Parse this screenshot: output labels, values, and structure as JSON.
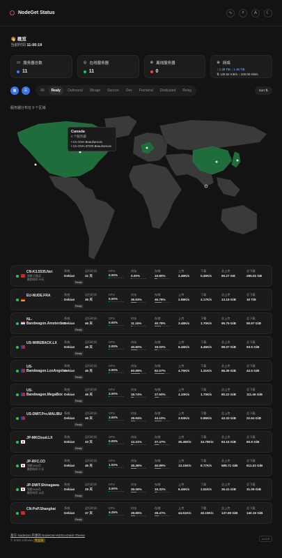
{
  "header": {
    "title": "NodeGet Status",
    "icons": [
      "activity-icon",
      "search-icon",
      "translate-icon",
      "theme-icon"
    ]
  },
  "greeting": "👋 概览",
  "time": {
    "label": "当前时间",
    "value": "11:00:19"
  },
  "cards": [
    {
      "title": "服务器总数",
      "value": "11",
      "color": "#3b82f6"
    },
    {
      "title": "在线服务器",
      "value": "11",
      "color": "#22c55e"
    },
    {
      "title": "离线服务器",
      "value": "0",
      "color": "#ef4444"
    },
    {
      "title": "网络",
      "line1": "↑ 1.38 TiB  ↓ 1.46 TiB",
      "line2": "⇅ 125.62 KiB/s  ↓ 100.05 KiB/s"
    }
  ],
  "toolbar": {
    "tabs": [
      "All",
      "Realy",
      "Outbound",
      "Mirage",
      "Service",
      "Dev",
      "Frontend",
      "Dedicated",
      "Relay"
    ],
    "active": "Realy",
    "sort": "Sort ⇅"
  },
  "map": {
    "note": "服务器分布在 9 个区域",
    "tooltip": {
      "country": "Canada",
      "count": "2 个服务器",
      "servers": [
        "CA-OVH.Beauharnois",
        "CA-OVH.STOR.Beauharnois"
      ]
    }
  },
  "labels": {
    "system": "系统",
    "uptime": "运行时间",
    "cpu": "CPU",
    "mem": "内存",
    "disk": "存储",
    "up": "上传",
    "down": "下载",
    "total_up": "总上传",
    "total_down": "总下载"
  },
  "servers": [
    {
      "name": "CN-K3.5535.Net",
      "meta1": "到期 已购买",
      "meta2": "剩余时间 29天",
      "flag": "cn",
      "os": "Debian",
      "uptime": "31 天",
      "cpu": "0.00%",
      "mem": "0.00%",
      "disk": "19.80%",
      "up": "2.48K/s",
      "down": "0.49K/s",
      "tup": "60.27 GB",
      "tdown": "285.02 GB",
      "cpu_p": 0,
      "mem_p": 0,
      "disk_p": 0.2
    },
    {
      "name": "EU-NUDE.FRA",
      "meta1": "",
      "meta2": "",
      "flag": "de",
      "os": "Debian",
      "uptime": "35 天",
      "cpu": "0.00%",
      "mem": "36.93%",
      "disk": "46.78%",
      "up": "2.98K/s",
      "down": "4.17K/s",
      "tup": "13.19 GiB",
      "tdown": "16 TiB",
      "cpu_p": 0,
      "mem_p": 0.37,
      "disk_p": 0.47
    },
    {
      "name": "NL-Bandwagon.Amsterdam",
      "meta1": "",
      "meta2": "",
      "flag": "nl",
      "os": "Debian",
      "uptime": "46 天",
      "cpu": "0.00%",
      "mem": "11.15%",
      "disk": "40.78%",
      "up": "3.48K/s",
      "down": "1.70K/s",
      "tup": "95.75 GiB",
      "tdown": "90.97 GiB",
      "cpu_p": 0,
      "mem_p": 0.11,
      "disk_p": 0.41
    },
    {
      "name": "US-WIREBACK.LX",
      "meta1": "",
      "meta2": "",
      "flag": "us",
      "os": "Debian",
      "uptime": "46 天",
      "cpu": "2.00%",
      "mem": "40.60%",
      "disk": "19.02%",
      "up": "6.46K/s",
      "down": "4.46K/s",
      "tup": "98.07 GiB",
      "tdown": "93.5 GiB",
      "cpu_p": 0.02,
      "mem_p": 0.41,
      "disk_p": 0.19
    },
    {
      "name": "US-Bandwagon.LosAngeles",
      "meta1": "",
      "meta2": "",
      "flag": "us",
      "os": "Debian",
      "uptime": "46 天",
      "cpu": "2.00%",
      "mem": "60.99%",
      "disk": "62.57%",
      "up": "4.75K/s",
      "down": "1.31K/s",
      "tup": "65.39 GiB",
      "tdown": "43.5 GiB",
      "cpu_p": 0.02,
      "mem_p": 0.61,
      "disk_p": 0.63
    },
    {
      "name": "US-Bandwagon.MegaBox",
      "meta1": "",
      "meta2": "",
      "flag": "us",
      "os": "Debian",
      "uptime": "46 天",
      "cpu": "2.00%",
      "mem": "18.74%",
      "disk": "27.50%",
      "up": "4.10K/s",
      "down": "1.70K/s",
      "tup": "80.22 GiB",
      "tdown": "111.46 GiB",
      "cpu_p": 0.02,
      "mem_p": 0.19,
      "disk_p": 0.28
    },
    {
      "name": "US-DMIT.Pro.MALIBU",
      "meta1": "",
      "meta2": "",
      "flag": "us",
      "os": "Debian",
      "uptime": "46 天",
      "cpu": "3.00%",
      "mem": "28.94%",
      "disk": "44.10%",
      "up": "3.93K/s",
      "down": "0.86K/s",
      "tup": "43.33 GiB",
      "tdown": "22.64 GiB",
      "cpu_p": 0.03,
      "mem_p": 0.29,
      "disk_p": 0.44
    },
    {
      "name": "JP-MKCloud.LX",
      "meta1": "",
      "meta2": "",
      "flag": "jp",
      "os": "Debian",
      "uptime": "33 天",
      "cpu": "0.00%",
      "mem": "13.41%",
      "disk": "27.47%",
      "up": "35.45K/s",
      "down": "34.78K/s",
      "tup": "63.16 GiB",
      "tdown": "60.9 GiB",
      "cpu_p": 0,
      "mem_p": 0.13,
      "disk_p": 0.27
    },
    {
      "name": "JP-RFC.CO",
      "meta1": "到期 ¥30/月",
      "meta2": "剩余时间 27天",
      "flag": "jp",
      "os": "Debian",
      "uptime": "46 天",
      "cpu": "1.02%",
      "mem": "35.36%",
      "disk": "40.89%",
      "up": "13.15K/s",
      "down": "8.77K/s",
      "tup": "589.71 GiB",
      "tdown": "611.02 GiB",
      "cpu_p": 0.01,
      "mem_p": 0.35,
      "disk_p": 0.41
    },
    {
      "name": "JP-DMIT.Shinagawa",
      "meta1": "到期 ¥49/月",
      "meta2": "剩余时间 18天",
      "flag": "jp",
      "os": "Debian",
      "uptime": "29 天",
      "cpu": "3.00%",
      "mem": "35.09%",
      "disk": "16.32%",
      "up": "6.45K/s",
      "down": "1.51K/s",
      "tup": "36.41 GiB",
      "tdown": "31.09 GiB",
      "cpu_p": 0.03,
      "mem_p": 0.35,
      "disk_p": 0.16
    },
    {
      "name": "CN-PoP.Shanghai",
      "meta1": "",
      "meta2": "",
      "flag": "cn",
      "os": "Debian",
      "uptime": "37 天",
      "cpu": "4.25%",
      "mem": "28.85%",
      "disk": "28.47%",
      "up": "44.61K/s",
      "down": "40.19K/s",
      "tup": "137.69 GiB",
      "tdown": "140.15 GiB",
      "cpu_p": 0.04,
      "mem_p": 0.29,
      "disk_p": 0.28
    }
  ],
  "footer": {
    "line1": "基于 NodeGet 开源的 NodeGet-HiDGo-Dash-Theme",
    "line2": "© 2025 x1flowa",
    "tag": "专业版",
    "version": "v1.0.0"
  }
}
